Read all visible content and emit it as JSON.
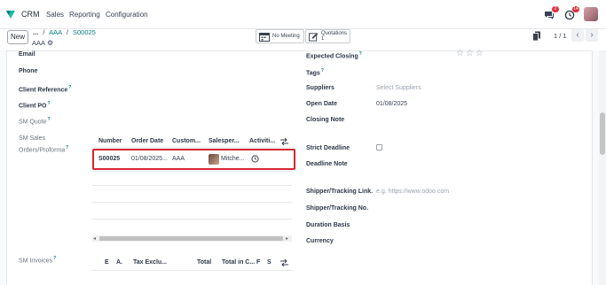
{
  "app": {
    "name": "CRM"
  },
  "nav": {
    "items": [
      "Sales",
      "Reporting",
      "Configuration"
    ],
    "chat_badge": "2",
    "activity_badge": "14"
  },
  "control_panel": {
    "new_label": "New",
    "breadcrumb_ellipsis": "...",
    "breadcrumbs": [
      "AAA",
      "S00025"
    ],
    "record_name": "AAA",
    "smart_buttons": [
      {
        "label": "No Meeting"
      },
      {
        "label": "Quotations",
        "count": "1"
      }
    ],
    "pager": "1 / 1"
  },
  "left_fields": {
    "email": "Email",
    "phone": "Phone",
    "client_reference": "Client Reference",
    "client_po": "Client PO",
    "sm_quote": "SM Quote",
    "sm_sales_orders_line1": "SM Sales",
    "sm_sales_orders_line2": "Orders/Proforma",
    "sm_invoices": "SM Invoices"
  },
  "orders_table": {
    "headers": [
      "Number",
      "Order Date",
      "Custom...",
      "Salesper...",
      "Activiti..."
    ],
    "rows": [
      {
        "number": "S00025",
        "order_date": "01/08/2025...",
        "customer": "AAA",
        "salesperson": "Mitche..."
      }
    ]
  },
  "invoices_table": {
    "headers": [
      "E",
      "A.",
      "Tax Exclu...",
      "Total",
      "Total in C...",
      "F",
      "S"
    ]
  },
  "right_fields": {
    "expected_closing": "Expected Closing",
    "tags": "Tags",
    "suppliers": "Suppliers",
    "suppliers_placeholder": "Select Suppliers",
    "open_date": "Open Date",
    "open_date_value": "01/08/2025",
    "closing_note": "Closing Note",
    "strict_deadline": "Strict Deadline",
    "deadline_note": "Deadline Note",
    "tracking_link": "Shipper/Tracking Link.",
    "tracking_link_placeholder": "e.g. https://www.odoo.com",
    "tracking_no": "Shipper/Tracking No.",
    "duration_basis": "Duration Basis",
    "currency": "Currency"
  },
  "colors": {
    "brand": "#017e84",
    "new_button_border": "#a0a6ad",
    "highlight": "#d62631",
    "badge": "#e0303f"
  }
}
